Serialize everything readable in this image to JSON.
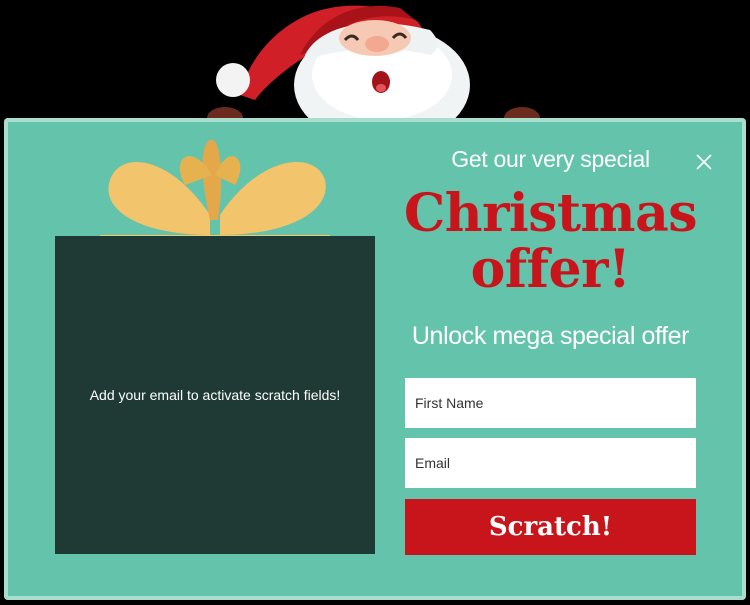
{
  "popup": {
    "lead": "Get our very special",
    "headline": "Christmas offer!",
    "subheadline": "Unlock mega special offer",
    "scratch_hint": "Add your email to activate scratch fields!",
    "first_name_placeholder": "First Name",
    "email_placeholder": "Email",
    "cta_label": "Scratch!"
  },
  "colors": {
    "panel": "#64c3ab",
    "scratch_area": "#1f3a34",
    "accent_red": "#c8151b",
    "bow_yellow": "#f2c46b"
  },
  "icons": {
    "close": "close-icon",
    "bow": "gift-bow-icon",
    "santa": "santa-illustration"
  }
}
